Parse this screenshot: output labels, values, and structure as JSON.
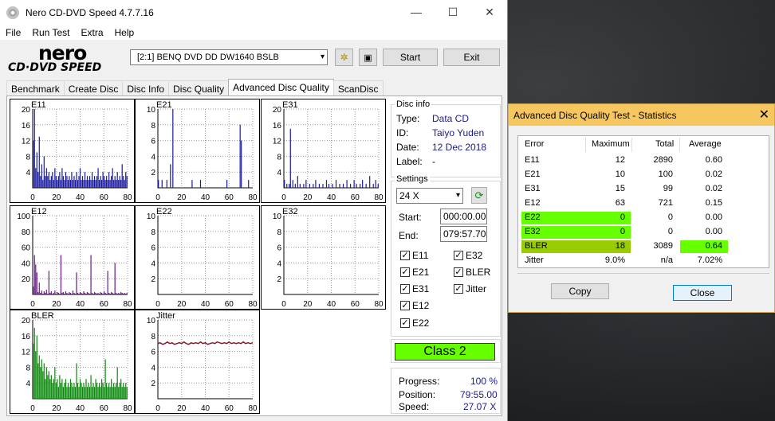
{
  "window": {
    "title": "Nero CD-DVD Speed 4.7.7.16",
    "controls": {
      "minimize": "—",
      "maximize": "☐",
      "close": "✕"
    }
  },
  "menu": [
    "File",
    "Run Test",
    "Extra",
    "Help"
  ],
  "logo": {
    "top": "nero",
    "bottom": "CD·DVD SPEED"
  },
  "toolbar": {
    "drive": "[2:1]   BENQ DVD DD DW1640 BSLB",
    "start_label": "Start",
    "exit_label": "Exit"
  },
  "tabs": [
    "Benchmark",
    "Create Disc",
    "Disc Info",
    "Disc Quality",
    "Advanced Disc Quality",
    "ScanDisc"
  ],
  "active_tab": "Advanced Disc Quality",
  "disc_info": {
    "title": "Disc info",
    "type_label": "Type:",
    "type": "Data CD",
    "id_label": "ID:",
    "id": "Taiyo Yuden",
    "date_label": "Date:",
    "date": "12 Dec 2018",
    "label_label": "Label:",
    "label": "-"
  },
  "settings": {
    "title": "Settings",
    "speed": "24 X",
    "start_label": "Start:",
    "start": "000:00.00",
    "end_label": "End:",
    "end": "079:57.70",
    "checks": [
      {
        "label": "E11",
        "checked": true
      },
      {
        "label": "E32",
        "checked": true
      },
      {
        "label": "E21",
        "checked": true
      },
      {
        "label": "BLER",
        "checked": true
      },
      {
        "label": "E31",
        "checked": true
      },
      {
        "label": "Jitter",
        "checked": true
      },
      {
        "label": "E12",
        "checked": true
      },
      {
        "label": "E22",
        "checked": true
      }
    ]
  },
  "class_label": "Class 2",
  "progress": {
    "progress_label": "Progress:",
    "progress": "100 %",
    "position_label": "Position:",
    "position": "79:55.00",
    "speed_label": "Speed:",
    "speed": "27.07 X"
  },
  "colors": {
    "accent_green": "#66ff00",
    "chart_blue": "#1a1aa0",
    "chart_purple": "#6a1a8a",
    "chart_green": "#0a8a0a",
    "jitter_red": "#8a1a2a"
  },
  "chart_data": [
    {
      "type": "bar",
      "title": "E11",
      "ylim": [
        0,
        20
      ],
      "yticks": [
        20,
        16,
        12,
        8,
        4
      ],
      "xticks": [
        0,
        20,
        40,
        60,
        80
      ],
      "series": [
        {
          "values": [
            12,
            20,
            5,
            9,
            4,
            13,
            3,
            6,
            2,
            8,
            3,
            5,
            3,
            4,
            2,
            3,
            4,
            2,
            5,
            3,
            2,
            3,
            4,
            2,
            5,
            3,
            2,
            4,
            3,
            2,
            3,
            2,
            4,
            2,
            3,
            2,
            4,
            2,
            3,
            5,
            2,
            3,
            2,
            4,
            2,
            3,
            2,
            3,
            2,
            4,
            2,
            3,
            2,
            3,
            5,
            2,
            3,
            2,
            4,
            3,
            2,
            3,
            2,
            4,
            2,
            3,
            5,
            2,
            3,
            2,
            4,
            2,
            3,
            2,
            6,
            3,
            2,
            4,
            3
          ]
        }
      ]
    },
    {
      "type": "bar",
      "title": "E21",
      "ylim": [
        0,
        10
      ],
      "yticks": [
        10,
        8,
        6,
        4,
        2
      ],
      "xticks": [
        0,
        20,
        40,
        60,
        80
      ],
      "series": [
        {
          "values": [
            1,
            0,
            0,
            1,
            0,
            0,
            0,
            1,
            0,
            0,
            3,
            0,
            10,
            0,
            0,
            0,
            0,
            0,
            0,
            0,
            0,
            0,
            0,
            0,
            0,
            0,
            0,
            0,
            1,
            0,
            0,
            0,
            0,
            0,
            0,
            1,
            0,
            0,
            0,
            0,
            0,
            0,
            0,
            0,
            0,
            0,
            0,
            0,
            0,
            0,
            0,
            0,
            0,
            0,
            0,
            0,
            0,
            1,
            0,
            0,
            0,
            0,
            0,
            0,
            0,
            0,
            0,
            0,
            8,
            6,
            0,
            0,
            0,
            0,
            0,
            1,
            0,
            0,
            0
          ]
        }
      ]
    },
    {
      "type": "bar",
      "title": "E31",
      "ylim": [
        0,
        20
      ],
      "yticks": [
        20,
        16,
        12,
        8,
        4
      ],
      "xticks": [
        0,
        20,
        40,
        60,
        80
      ],
      "series": [
        {
          "values": [
            2,
            0,
            1,
            0,
            1,
            15,
            0,
            2,
            0,
            1,
            0,
            3,
            0,
            1,
            0,
            0,
            1,
            0,
            2,
            0,
            0,
            1,
            0,
            0,
            1,
            0,
            2,
            0,
            0,
            1,
            0,
            0,
            1,
            0,
            0,
            2,
            0,
            1,
            0,
            0,
            1,
            0,
            0,
            2,
            0,
            0,
            1,
            0,
            0,
            1,
            0,
            0,
            2,
            0,
            0,
            1,
            0,
            0,
            2,
            0,
            1,
            0,
            0,
            1,
            0,
            2,
            0,
            0,
            1,
            0,
            0,
            3,
            0,
            0,
            1,
            0,
            2,
            0,
            1
          ]
        }
      ]
    },
    {
      "type": "bar",
      "title": "E12",
      "ylim": [
        0,
        100
      ],
      "yticks": [
        100,
        80,
        60,
        40,
        20
      ],
      "xticks": [
        0,
        20,
        40,
        60,
        80
      ],
      "series": [
        {
          "values": [
            10,
            50,
            38,
            28,
            3,
            15,
            2,
            5,
            1,
            4,
            2,
            6,
            1,
            30,
            2,
            4,
            1,
            2,
            5,
            1,
            3,
            2,
            1,
            50,
            2,
            3,
            1,
            4,
            2,
            1,
            3,
            2,
            1,
            5,
            2,
            1,
            28,
            2,
            1,
            3,
            2,
            1,
            4,
            2,
            1,
            3,
            2,
            1,
            50,
            2,
            1,
            3,
            2,
            1,
            2,
            1,
            3,
            2,
            1,
            4,
            2,
            1,
            30,
            2,
            1,
            3,
            2,
            1,
            40,
            2,
            1,
            2,
            1,
            3,
            2,
            1,
            2,
            1,
            2
          ]
        }
      ]
    },
    {
      "type": "bar",
      "title": "E22",
      "ylim": [
        0,
        10
      ],
      "yticks": [
        10,
        8,
        6,
        4,
        2
      ],
      "xticks": [
        0,
        20,
        40,
        60,
        80
      ],
      "series": [
        {
          "values": []
        }
      ]
    },
    {
      "type": "bar",
      "title": "E32",
      "ylim": [
        0,
        10
      ],
      "yticks": [
        10,
        8,
        6,
        4,
        2
      ],
      "xticks": [
        0,
        20,
        40,
        60,
        80
      ],
      "series": [
        {
          "values": []
        }
      ]
    },
    {
      "type": "bar",
      "title": "BLER",
      "ylim": [
        0,
        20
      ],
      "yticks": [
        20,
        16,
        12,
        8,
        4
      ],
      "xticks": [
        0,
        20,
        40,
        60,
        80
      ],
      "series": [
        {
          "values": [
            14,
            18,
            12,
            16,
            9,
            11,
            8,
            10,
            7,
            9,
            5,
            8,
            6,
            7,
            5,
            6,
            4,
            5,
            8,
            4,
            5,
            3,
            6,
            4,
            5,
            3,
            4,
            5,
            3,
            4,
            3,
            5,
            4,
            3,
            4,
            3,
            9,
            4,
            3,
            5,
            4,
            3,
            4,
            3,
            5,
            3,
            4,
            3,
            6,
            3,
            4,
            3,
            5,
            4,
            3,
            4,
            3,
            5,
            4,
            3,
            10,
            4,
            3,
            4,
            3,
            5,
            3,
            4,
            3,
            4,
            8,
            3,
            4,
            5,
            3,
            4,
            3,
            4,
            3
          ]
        }
      ]
    },
    {
      "type": "line",
      "title": "Jitter",
      "ylim": [
        0,
        10
      ],
      "yticks": [
        10,
        8,
        6,
        4,
        2
      ],
      "xticks": [
        0,
        20,
        40,
        60,
        80
      ],
      "series": [
        {
          "values": [
            7.0,
            7.1,
            6.9,
            7.0,
            7.2,
            7.0,
            7.1,
            6.9,
            7.0,
            7.1,
            7.0,
            7.2,
            7.0,
            6.9,
            7.1,
            7.0,
            7.1,
            7.0,
            7.2,
            7.0,
            7.1,
            6.9,
            7.0,
            7.1,
            7.0,
            7.2,
            7.1,
            7.0,
            7.1,
            7.0,
            7.2,
            7.0,
            7.1,
            7.0,
            7.1,
            7.0,
            7.2,
            7.0,
            7.1,
            7.0,
            7.1
          ]
        }
      ]
    }
  ],
  "stats": {
    "title": "Advanced Disc Quality Test - Statistics",
    "close_glyph": "✕",
    "headers": [
      "Error",
      "Maximum",
      "Total",
      "Average"
    ],
    "rows": [
      {
        "error": "E11",
        "maximum": "12",
        "total": "2890",
        "average": "0.60",
        "hl_max": false,
        "hl_avg": false,
        "hl_err": false
      },
      {
        "error": "E21",
        "maximum": "10",
        "total": "100",
        "average": "0.02",
        "hl_max": false,
        "hl_avg": false,
        "hl_err": false
      },
      {
        "error": "E31",
        "maximum": "15",
        "total": "99",
        "average": "0.02",
        "hl_max": false,
        "hl_avg": false,
        "hl_err": false
      },
      {
        "error": "E12",
        "maximum": "63",
        "total": "721",
        "average": "0.15",
        "hl_max": false,
        "hl_avg": false,
        "hl_err": false
      },
      {
        "error": "E22",
        "maximum": "0",
        "total": "0",
        "average": "0.00",
        "hl_max": true,
        "hl_avg": false,
        "hl_err": true
      },
      {
        "error": "E32",
        "maximum": "0",
        "total": "0",
        "average": "0.00",
        "hl_max": true,
        "hl_avg": false,
        "hl_err": true
      },
      {
        "error": "BLER",
        "maximum": "18",
        "total": "3089",
        "average": "0.64",
        "hl_max": true,
        "hl_avg": true,
        "hl_err": true,
        "olive": true
      },
      {
        "error": "Jitter",
        "maximum": "9.0%",
        "total": "n/a",
        "average": "7.02%",
        "hl_max": false,
        "hl_avg": false,
        "hl_err": false
      }
    ],
    "copy_label": "Copy",
    "close_label": "Close"
  }
}
